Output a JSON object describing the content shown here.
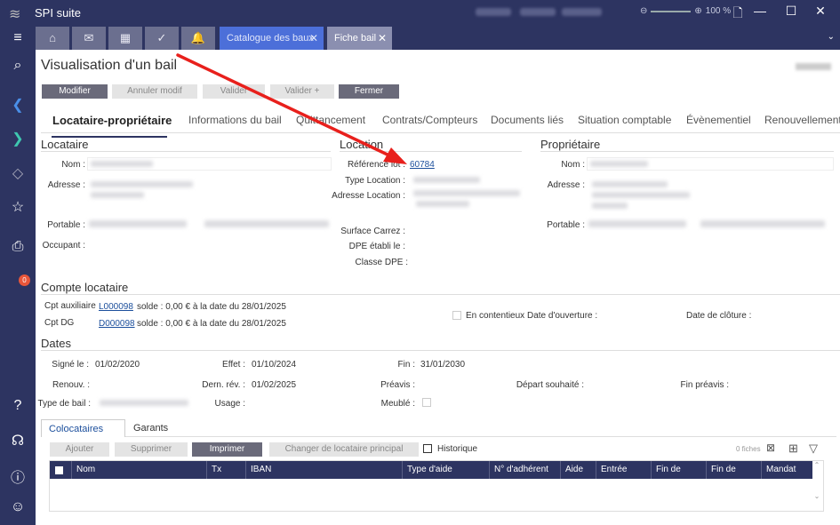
{
  "app": {
    "title": "SPI suite",
    "zoom": "100 %"
  },
  "doc_tabs": [
    {
      "label": "Catalogue des baux"
    },
    {
      "label": "Fiche bail"
    }
  ],
  "page": {
    "title": "Visualisation d'un bail"
  },
  "toolbar": {
    "modifier": "Modifier",
    "annuler": "Annuler modif",
    "valider": "Valider",
    "valider_plus": "Valider +",
    "fermer": "Fermer"
  },
  "sub_tabs": [
    "Locataire-propriétaire",
    "Informations du bail",
    "Quittancement",
    "Contrats/Compteurs",
    "Documents liés",
    "Situation comptable",
    "Évènementiel",
    "Renouvellement"
  ],
  "locataire": {
    "section": "Locataire",
    "nom": "Nom :",
    "adresse": "Adresse :",
    "portable": "Portable :",
    "occupant": "Occupant :"
  },
  "location": {
    "section": "Location",
    "ref_label": "Référence lot :",
    "ref_value": "60784",
    "type": "Type Location :",
    "adresse": "Adresse Location :",
    "surface": "Surface Carrez :",
    "dpe_etabli": "DPE établi le :",
    "classe_dpe": "Classe DPE :"
  },
  "proprietaire": {
    "section": "Propriétaire",
    "nom": "Nom :",
    "adresse": "Adresse :",
    "portable": "Portable :"
  },
  "compte": {
    "section": "Compte locataire",
    "aux_label": "Cpt auxiliaire",
    "aux_code": "L000098",
    "aux_solde": "solde : 0,00 € à la date du 28/01/2025",
    "dg_label": "Cpt DG",
    "dg_code": "D000098",
    "dg_solde": "solde : 0,00 € à la date du 28/01/2025",
    "contentieux": "En contentieux",
    "date_ouverture": "Date d'ouverture :",
    "date_cloture": "Date de clôture :"
  },
  "dates": {
    "section": "Dates",
    "signe_label": "Signé le :",
    "signe": "01/02/2020",
    "effet_label": "Effet :",
    "effet": "01/10/2024",
    "fin_label": "Fin :",
    "fin": "31/01/2030",
    "renouv": "Renouv. :",
    "dern_rev_label": "Dern. rév. :",
    "dern_rev": "01/02/2025",
    "preavis": "Préavis :",
    "depart": "Départ souhaité :",
    "fin_preavis": "Fin préavis :",
    "type_bail": "Type de bail :",
    "usage": "Usage :",
    "meuble": "Meublé :"
  },
  "bottom_tabs": [
    "Colocataires",
    "Garants"
  ],
  "grid_toolbar": {
    "ajouter": "Ajouter",
    "supprimer": "Supprimer",
    "imprimer": "Imprimer",
    "changer": "Changer de locataire principal",
    "historique": "Historique",
    "count": "0 fiches"
  },
  "grid_columns": [
    "Nom",
    "Tx prél...",
    "IBAN",
    "Type d'aide",
    "N° d'adhérent",
    "Aide",
    "Entrée",
    "Fin de préa...",
    "Fin de solid...",
    "Mandat"
  ],
  "colors": {
    "nav": "#2d3461",
    "accent": "#1c4f9c",
    "arrow": "#e8201c"
  }
}
